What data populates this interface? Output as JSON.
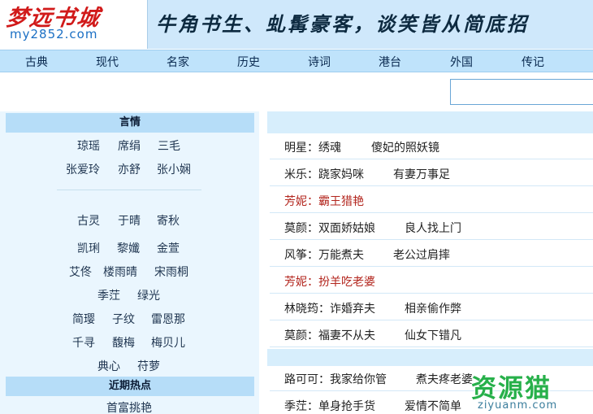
{
  "header": {
    "logo_title": "梦远书城",
    "logo_url": "my2852.com",
    "slogan": "牛角书生、虬髯豪客，谈笑皆从简底招"
  },
  "nav": [
    "古典",
    "现代",
    "名家",
    "历史",
    "诗词",
    "港台",
    "外国",
    "传记"
  ],
  "sidebar": {
    "section_title": "言情",
    "authors_row1": [
      "琼瑶",
      "席绢",
      "三毛"
    ],
    "authors_row2": [
      "张爱玲",
      "亦舒",
      "张小娴"
    ],
    "authors_row3": [
      "古灵",
      "于晴",
      "寄秋"
    ],
    "authors_row4": [
      "凯琍",
      "黎孅",
      "金萱"
    ],
    "authors_row5": [
      "艾佟",
      "楼雨晴",
      "宋雨桐"
    ],
    "authors_row6": [
      "季茳",
      "绿光"
    ],
    "authors_row7": [
      "简璎",
      "子纹",
      "雷恩那"
    ],
    "authors_row8": [
      "千寻",
      "馥梅",
      "梅贝儿"
    ],
    "authors_row9": [
      "典心",
      "苻萝"
    ],
    "hot_title": "近期热点",
    "hot_first": "首富挑艳"
  },
  "content": {
    "rows": [
      {
        "author": "明星：绣魂",
        "book": "傻妃的照妖镜",
        "red": false
      },
      {
        "author": "米乐：跷家妈咪",
        "book": "有妻万事足",
        "red": false
      },
      {
        "author": "芳妮：霸王猎艳",
        "book": "",
        "red": true
      },
      {
        "author": "莫颜：双面娇姑娘",
        "book": "良人找上门",
        "red": false
      },
      {
        "author": "风筝：万能煮夫",
        "book": "老公过肩摔",
        "red": false
      },
      {
        "author": "芳妮：扮羊吃老婆",
        "book": "",
        "red": true
      },
      {
        "author": "林晓筠：诈婚弃夫",
        "book": "相亲偷作弊",
        "red": false
      },
      {
        "author": "莫颜：福妻不从夫",
        "book": "仙女下错凡",
        "red": false
      },
      {
        "author": "路可可：我家给你管",
        "book": "煮夫疼老婆",
        "red": false
      },
      {
        "author": "季茳：单身抢手货",
        "book": "爱情不简单",
        "red": false
      }
    ]
  },
  "watermark": {
    "cn": "资源猫",
    "en": "ziyuanm.com"
  },
  "colors": {
    "banner_bg": "#cfe8fb",
    "nav_bg": "#bfe3fb",
    "sidebar_bg": "#eaf6fe",
    "section_head_bg": "#b6ddf8",
    "logo_red": "#d11a1a",
    "highlight_red": "#b3261e",
    "watermark_green": "#27b04a"
  }
}
